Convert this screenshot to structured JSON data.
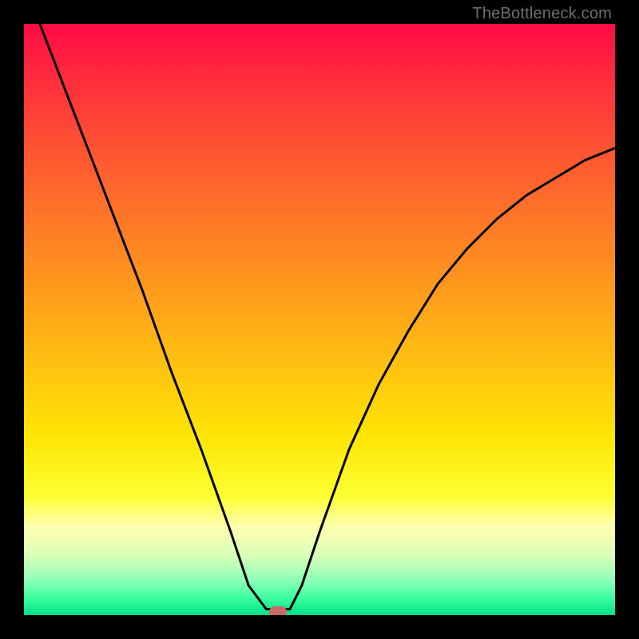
{
  "watermark": "TheBottleneck.com",
  "chart_data": {
    "type": "line",
    "title": "",
    "xlabel": "",
    "ylabel": "",
    "xlim": [
      0,
      1
    ],
    "ylim": [
      0,
      1
    ],
    "series": [
      {
        "name": "bottleneck-curve",
        "x": [
          0.0,
          0.05,
          0.1,
          0.15,
          0.2,
          0.25,
          0.3,
          0.35,
          0.38,
          0.41,
          0.44,
          0.45,
          0.47,
          0.5,
          0.55,
          0.6,
          0.65,
          0.7,
          0.75,
          0.8,
          0.85,
          0.9,
          0.95,
          1.0
        ],
        "values": [
          1.07,
          0.94,
          0.81,
          0.68,
          0.55,
          0.41,
          0.28,
          0.14,
          0.05,
          0.01,
          0.01,
          0.01,
          0.05,
          0.14,
          0.28,
          0.39,
          0.48,
          0.56,
          0.62,
          0.67,
          0.71,
          0.74,
          0.77,
          0.79
        ]
      }
    ],
    "optimal_marker": {
      "x": 0.43,
      "y": 0.005
    },
    "background_gradient": {
      "top": "#ff0b44",
      "middle": "#ffe605",
      "bottom": "#00e088"
    }
  },
  "colors": {
    "frame": "#000000",
    "curve": "#000000",
    "marker": "#c96a63",
    "watermark": "#6f6f6f"
  }
}
